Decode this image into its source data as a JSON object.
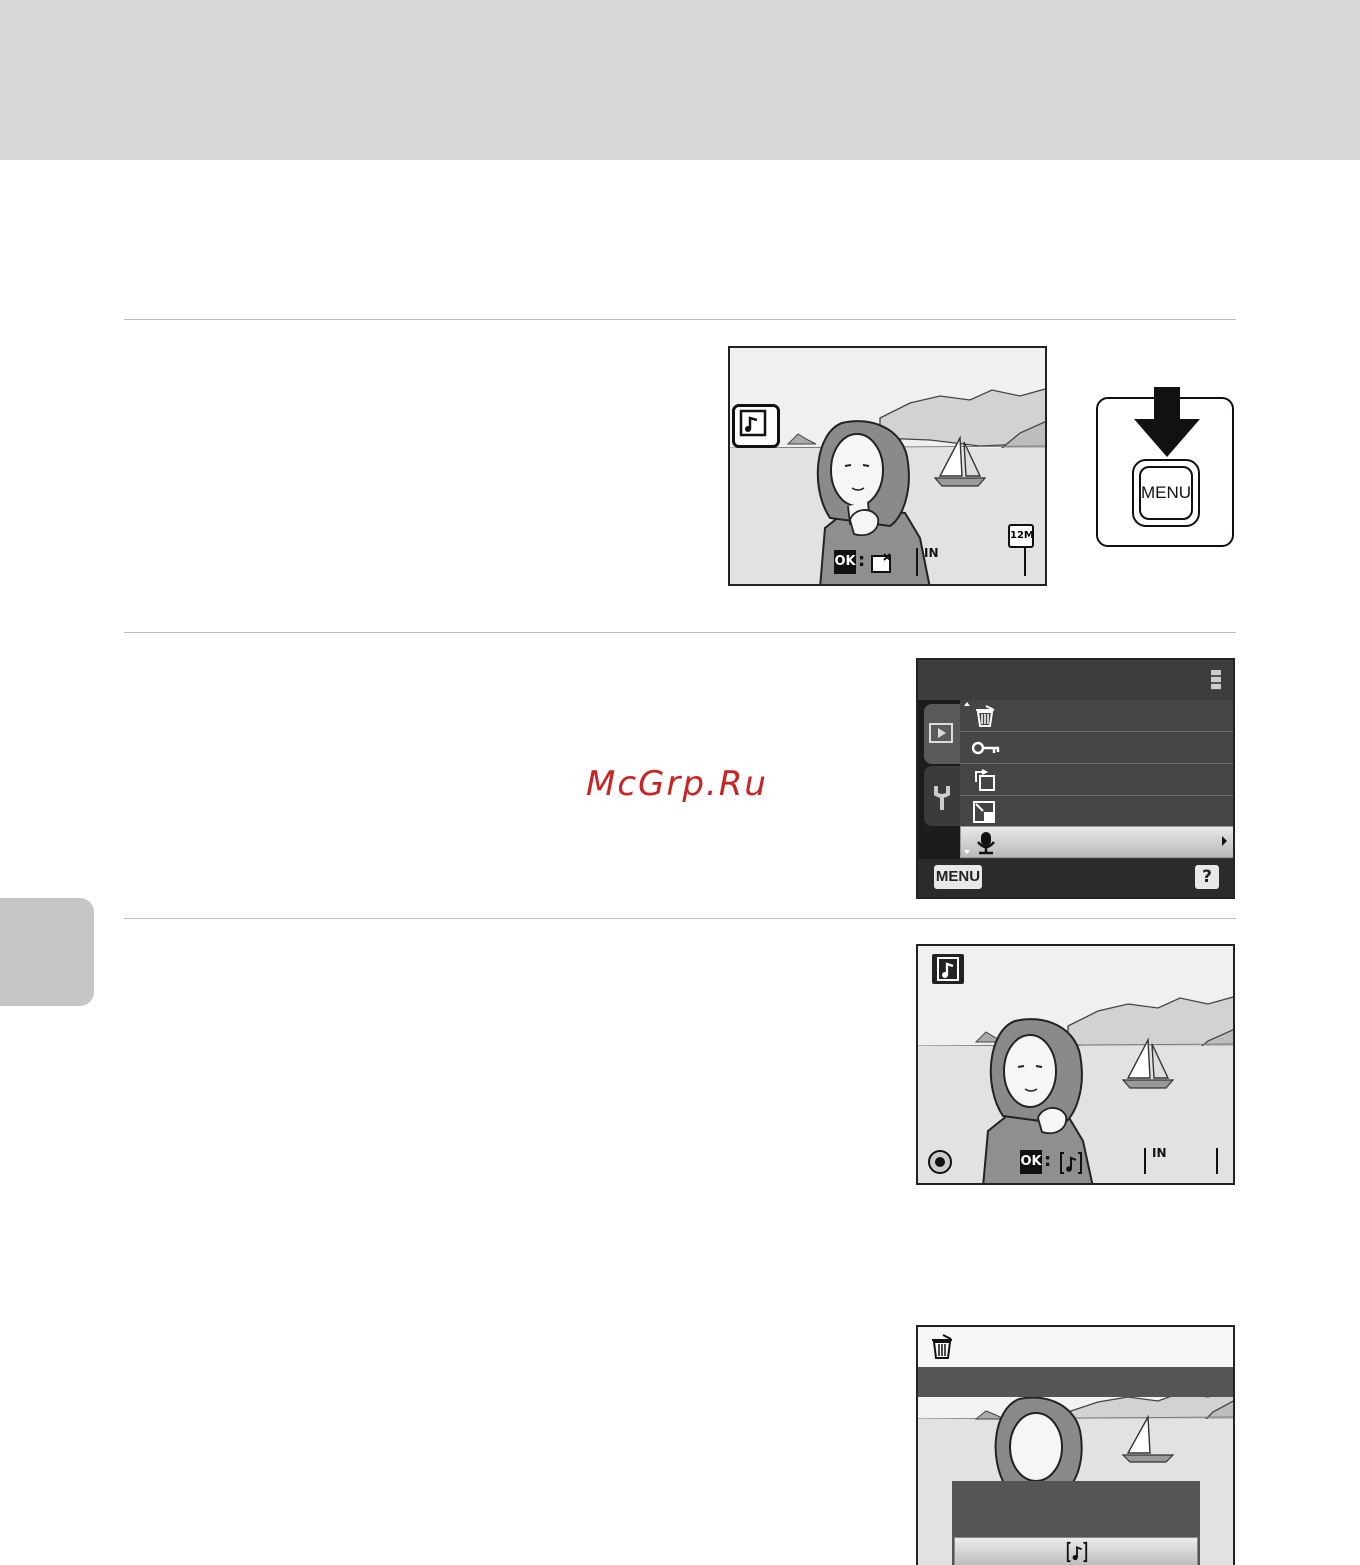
{
  "menu_button": {
    "label": "MENU"
  },
  "step1_screen": {
    "ok_label": "OK",
    "memory_label": "IN",
    "size_label": "12M"
  },
  "step2_menu": {
    "menu_label": "MENU",
    "help_label": "?"
  },
  "step3_screen": {
    "ok_label": "OK",
    "memory_label": "IN"
  },
  "watermark": "McGrp.Ru"
}
